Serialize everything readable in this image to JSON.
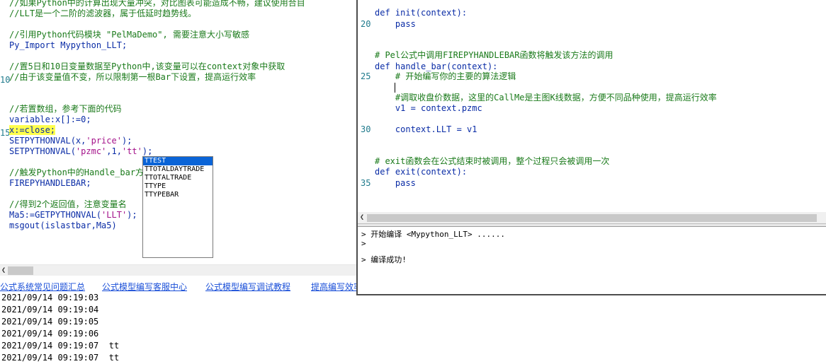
{
  "left_editor": {
    "lines": [
      {
        "text": "//如果Python中的计算出现大量冲突，对比图表可能造成不畅，建议使用合目",
        "cls": "cmt"
      },
      {
        "text": "//LLT是一个二阶的滤波器，属于低延时趋势线。",
        "cls": "cmt"
      },
      {
        "text": "",
        "cls": ""
      },
      {
        "text": "//引用Python代码模块 \"PelMaDemo\", 需要注意大小写敏感",
        "cls": "cmt"
      },
      {
        "text": "Py_Import Mypython_LLT;",
        "cls": "mixed_import"
      },
      {
        "text": "",
        "cls": ""
      },
      {
        "text": "//置5日和10日变量数据至Python中,该变量可以在context对象中获取",
        "cls": "cmt"
      },
      {
        "text": "//由于该变量值不变，所以限制第一根Bar下设置，提高运行效率",
        "cls": "cmt"
      },
      {
        "text": "",
        "cls": ""
      },
      {
        "text": "",
        "cls": ""
      },
      {
        "text": "//若置数组，参考下面的代码",
        "cls": "cmt"
      },
      {
        "text": "variable:x[]:=0;",
        "cls": "mixed_var"
      },
      {
        "text": "x:=close;",
        "cls": "mixed_x"
      },
      {
        "text": "SETPYTHONVAL(x,'price');",
        "cls": "mixed_set1"
      },
      {
        "text": "SETPYTHONVAL('pzmc',1,'tt');",
        "cls": "mixed_set2"
      },
      {
        "text": "",
        "cls": ""
      },
      {
        "text": "//触发Python中的Handle_bar方",
        "cls": "cmt"
      },
      {
        "text": "FIREPYHANDLEBAR;",
        "cls": "kw"
      },
      {
        "text": "",
        "cls": ""
      },
      {
        "text": "//得到2个返回值，注意变量名",
        "cls": "cmt"
      },
      {
        "text": "Ma5:=GETPYTHONVAL('LLT');",
        "cls": "mixed_get"
      },
      {
        "text": "msgout(islastbar,Ma5)",
        "cls": "kw"
      }
    ],
    "line_numbers": [
      {
        "row": 7,
        "label": "10"
      },
      {
        "row": 12,
        "label": "15"
      }
    ]
  },
  "autocomplete": {
    "items": [
      "TTEST",
      "TTOTALDAYTRADE",
      "TTOTALTRADE",
      "TTYPE",
      "TTYPEBAR"
    ],
    "selected": 0
  },
  "links": [
    "公式系统常见问题汇总",
    "公式模型编写客服中心",
    "公式模型编写调试教程",
    "提高编写效率"
  ],
  "output_log": [
    "2021/09/14 09:19:03",
    "2021/09/14 09:19:04",
    "2021/09/14 09:19:05",
    "2021/09/14 09:19:06",
    "2021/09/14 09:19:07  tt",
    "2021/09/14 09:19:07  tt"
  ],
  "python_editor": {
    "lines": [
      {
        "num": "",
        "text": "def init(context):",
        "cls": "pkw"
      },
      {
        "num": "20",
        "text": "    pass",
        "cls": "pkw"
      },
      {
        "num": "",
        "text": "",
        "cls": ""
      },
      {
        "num": "",
        "text": "",
        "cls": ""
      },
      {
        "num": "",
        "text": "# Pel公式中调用FIREPYHANDLEBAR函数将触发该方法的调用",
        "cls": "pcmt"
      },
      {
        "num": "",
        "text": "def handle_bar(context):",
        "cls": "pkw"
      },
      {
        "num": "25",
        "text": "    # 开始编写你的主要的算法逻辑",
        "cls": "pcmt"
      },
      {
        "num": "",
        "text": "",
        "cls": ""
      },
      {
        "num": "",
        "text": "    #调取收盘价数据，这里的CallMe是主图K线数据，方便不同品种使用，提高运行效率",
        "cls": "pcmt"
      },
      {
        "num": "",
        "text": "    v1 = context.pzmc",
        "cls": "pkw"
      },
      {
        "num": "",
        "text": "",
        "cls": ""
      },
      {
        "num": "30",
        "text": "    context.LLT = v1",
        "cls": "pkw"
      },
      {
        "num": "",
        "text": "",
        "cls": ""
      },
      {
        "num": "",
        "text": "",
        "cls": ""
      },
      {
        "num": "",
        "text": "# exit函数会在公式结束时被调用，整个过程只会被调用一次",
        "cls": "pcmt"
      },
      {
        "num": "",
        "text": "def exit(context):",
        "cls": "pkw"
      },
      {
        "num": "35",
        "text": "    pass",
        "cls": "pkw"
      }
    ]
  },
  "compile_output": [
    "> 开始编译 <Mypython_LLT> ......",
    ">",
    "",
    "> 编译成功!"
  ],
  "colors": {
    "comment": "#1a7a1a",
    "keyword": "#0a2ca6",
    "string": "#a4128a",
    "highlight": "#ffff4d",
    "selection": "#0a64d7",
    "link": "#1a4fd8"
  },
  "icons": {
    "left_scroll_arrow": "chevron-left-icon",
    "py_scroll_arrow": "chevron-left-icon"
  }
}
